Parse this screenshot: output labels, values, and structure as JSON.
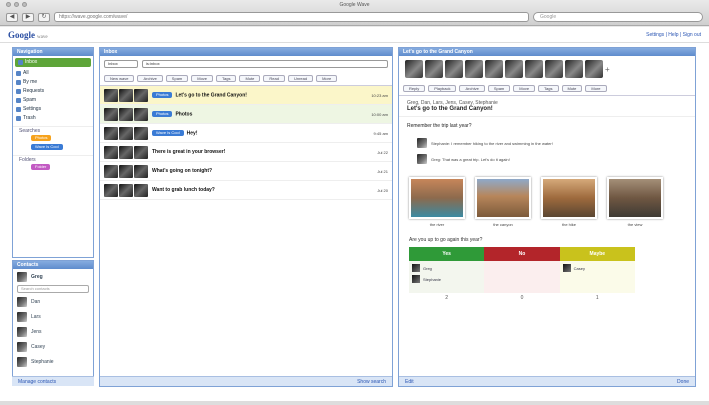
{
  "browser": {
    "title": "Google Wave",
    "url": "https://wave.google.com/wave/",
    "search_placeholder": "Google"
  },
  "app": {
    "logo": "Google",
    "logo_sub": "wave",
    "top_links": [
      "Settings",
      "Help",
      "Sign out"
    ]
  },
  "navigation": {
    "title": "Navigation",
    "items": [
      {
        "label": "Inbox",
        "active": true
      },
      {
        "label": "All"
      },
      {
        "label": "By me"
      },
      {
        "label": "Requests"
      },
      {
        "label": "Spam"
      },
      {
        "label": "Settings"
      },
      {
        "label": "Trash"
      }
    ],
    "searches_title": "Searches",
    "searches": [
      {
        "label": "Photos",
        "color": "#f6a21c"
      },
      {
        "label": "Wave Is Cool",
        "color": "#3a7bd5"
      }
    ],
    "folders_title": "Folders",
    "folders": [
      {
        "label": "Folder",
        "color": "#c25ac3"
      }
    ]
  },
  "contacts": {
    "title": "Contacts",
    "me": "Greg",
    "search_placeholder": "Search contacts",
    "list": [
      "Dan",
      "Lars",
      "Jens",
      "Casey",
      "Stephanie"
    ],
    "footer": "Manage contacts"
  },
  "inbox": {
    "title": "Inbox",
    "filter_select": "Inbox",
    "filter_input": "is:inbox",
    "tools": [
      "New wave",
      "Archive",
      "Spam",
      "Move",
      "Tags",
      "Mute",
      "Read",
      "Unread",
      "More"
    ],
    "messages": [
      {
        "label": "Photos",
        "label_color": "#3a7bd5",
        "subject": "Let's go to the Grand Canyon!",
        "snippet": "",
        "date": "10:23 am",
        "style": "sel1"
      },
      {
        "label": "Photos",
        "label_color": "#3a7bd5",
        "subject": "Photos",
        "snippet": "",
        "date": "10:00 am",
        "style": "sel2"
      },
      {
        "label": "Wave Is Cool",
        "label_color": "#3a7bd5",
        "subject": "Hey!",
        "snippet": "",
        "date": "9:45 am",
        "style": ""
      },
      {
        "label": "",
        "label_color": "",
        "subject": "There is great in your browser!",
        "snippet": "",
        "date": "Jul 22",
        "style": ""
      },
      {
        "label": "",
        "label_color": "",
        "subject": "What's going on tonight?",
        "snippet": "",
        "date": "Jul 21",
        "style": ""
      },
      {
        "label": "",
        "label_color": "",
        "subject": "Want to grab lunch today?",
        "snippet": "",
        "date": "Jul 20",
        "style": ""
      }
    ],
    "footer": "Show search"
  },
  "reader": {
    "title": "Let's go to the Grand Canyon",
    "tools": [
      "Reply",
      "Playback",
      "Archive",
      "Spam",
      "Move",
      "Tags",
      "Mute",
      "More"
    ],
    "meta": "Greg, Dan, Lars, Jens, Casey, Stephanie",
    "heading": "Let's go to the Grand Canyon!",
    "quote": "Remember the trip last year?",
    "replies": [
      "Stephanie: I remember hiking to the river and swimming in the water!",
      "Greg: That was a great trip. Let's do it again!"
    ],
    "photos": [
      {
        "caption": "the river",
        "gradient": "linear-gradient(180deg,#c7865a,#8c6a4d 50%,#3b8aa2)"
      },
      {
        "caption": "the canyon",
        "gradient": "linear-gradient(180deg,#8fa9c9,#b7865b 45%,#7c5a3a)"
      },
      {
        "caption": "the hike",
        "gradient": "linear-gradient(180deg,#d5a97a,#9e6a3d 50%,#5a4632)"
      },
      {
        "caption": "the view",
        "gradient": "linear-gradient(180deg,#a48f78,#6f5742 50%,#3e3a34)"
      }
    ],
    "vote_question": "Are you up to go again this year?",
    "votes": [
      {
        "header": "Yes",
        "color": "#2f9a38",
        "people": [
          "Greg",
          "Stephanie"
        ],
        "count": "2"
      },
      {
        "header": "No",
        "color": "#b3252a",
        "people": [],
        "count": "0"
      },
      {
        "header": "Maybe",
        "color": "#c9c21c",
        "people": [
          "Casey"
        ],
        "count": "1"
      }
    ],
    "footer_left": "Edit",
    "footer_right": "Done"
  }
}
